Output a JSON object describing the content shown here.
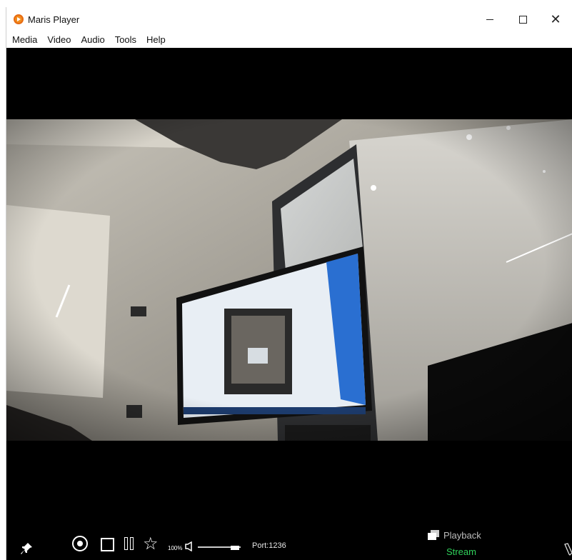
{
  "window": {
    "title": "Maris Player",
    "app_icon": "maris-player-logo",
    "controls": {
      "minimize_icon": "minimize-icon",
      "maximize_icon": "maximize-icon",
      "close_icon": "close-icon",
      "close_glyph": "✕"
    }
  },
  "menu": {
    "items": [
      "Media",
      "Video",
      "Audio",
      "Tools",
      "Help"
    ]
  },
  "player": {
    "video_content": "live camera feed of an office room with a monitor",
    "controls": {
      "pin_icon": "pin-icon",
      "record_icon": "record-icon",
      "stop_icon": "stop-icon",
      "pause_icon": "pause-icon",
      "star_icon": "star-icon",
      "star_glyph": "☆",
      "volume_percent": "100%",
      "volume_level": 1.0,
      "speaker_icon": "speaker-icon",
      "port_label": "Port:1236",
      "playback_icon": "playback-icon",
      "playback_label": "Playback",
      "stream_label": "Stream",
      "pen_icon": "pen-icon"
    }
  },
  "colors": {
    "app_accent": "#f28c1e",
    "stream_active": "#2fd15a",
    "playback_inactive": "#bdbdbd",
    "video_background": "#000000"
  }
}
